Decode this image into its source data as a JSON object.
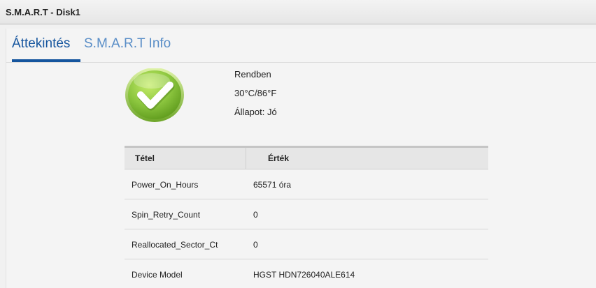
{
  "window": {
    "title": "S.M.A.R.T - Disk1"
  },
  "tabs": [
    {
      "label": "Áttekintés",
      "active": true
    },
    {
      "label": "S.M.A.R.T Info",
      "active": false
    }
  ],
  "summary": {
    "icon": "check-icon",
    "status": "Rendben",
    "temperature": "30°C/86°F",
    "health": "Állapot: Jó"
  },
  "table": {
    "columns": [
      "Tétel",
      "Érték"
    ],
    "rows": [
      [
        "Power_On_Hours",
        "65571 óra"
      ],
      [
        "Spin_Retry_Count",
        "0"
      ],
      [
        "Reallocated_Sector_Ct",
        "0"
      ],
      [
        "Device Model",
        "HGST HDN726040ALE614"
      ]
    ]
  },
  "colors": {
    "accent": "#15559e",
    "tab_inactive": "#5a8ec7",
    "check_green": "#8cc63f"
  }
}
